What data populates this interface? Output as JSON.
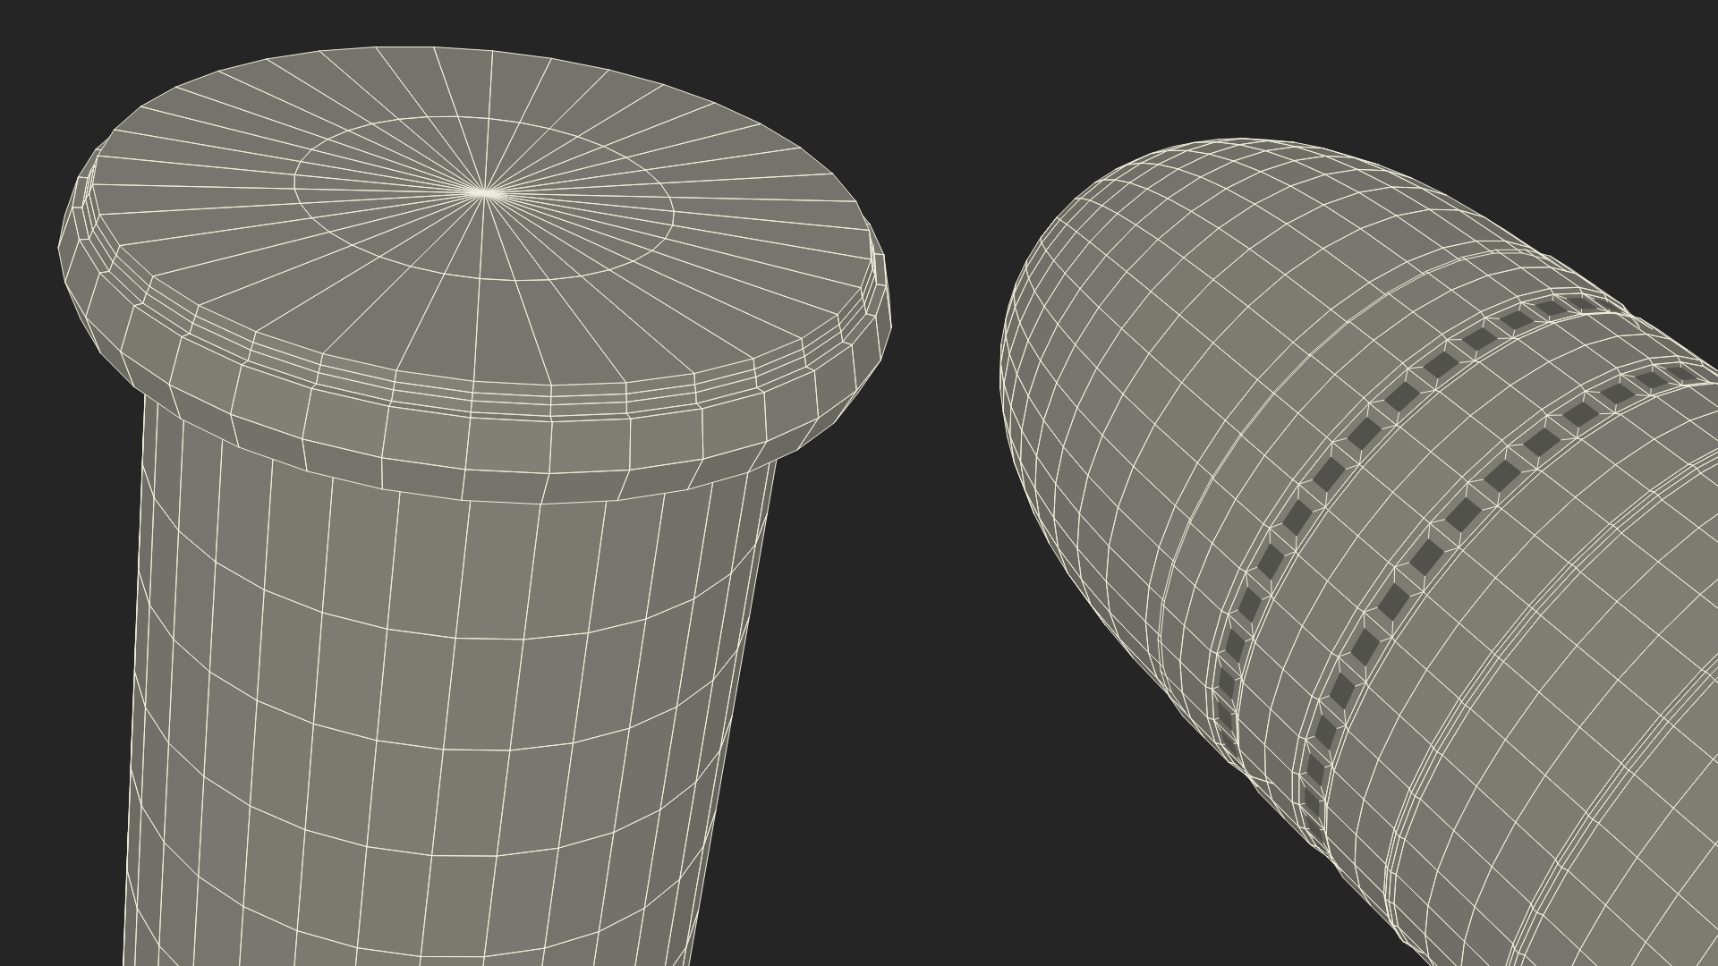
{
  "scene": {
    "objects": [
      {
        "kind": "flanged-cylinder"
      },
      {
        "kind": "bullet"
      }
    ]
  }
}
